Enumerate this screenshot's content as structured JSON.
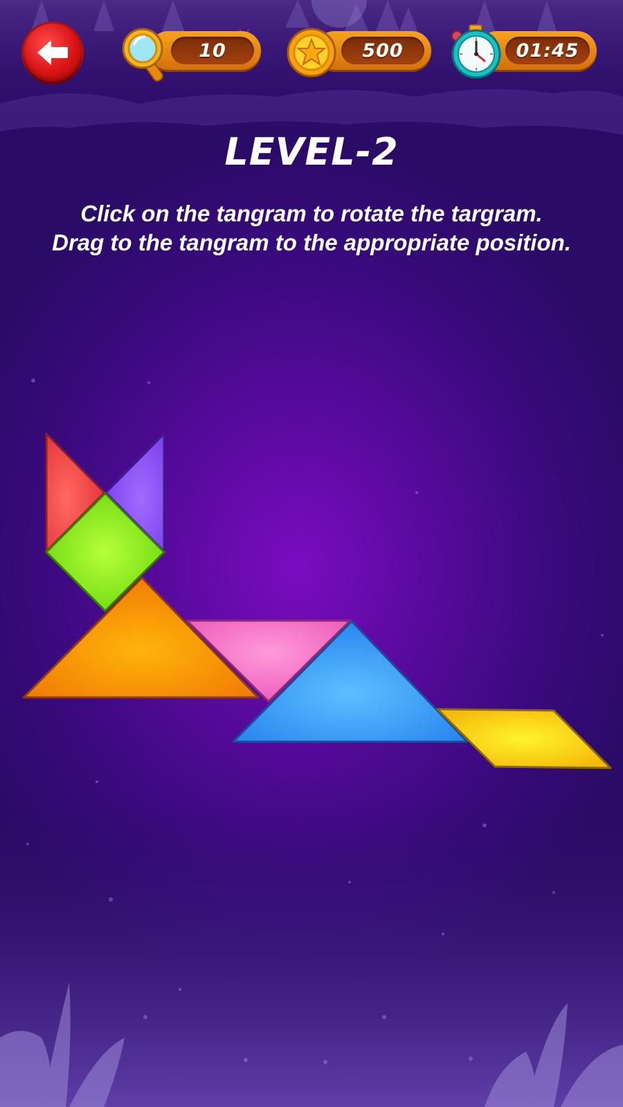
{
  "hud": {
    "back_icon": "arrow-left-icon",
    "hints": {
      "icon": "magnifier-icon",
      "value": "10"
    },
    "coins": {
      "icon": "star-coin-icon",
      "value": "500"
    },
    "timer": {
      "icon": "stopwatch-icon",
      "value": "01:45"
    }
  },
  "level": {
    "title": "LEVEL-2",
    "instruction_line1": "Click on the tangram to rotate the targram.",
    "instruction_line2": "Drag to the tangram to the appropriate position."
  },
  "colors": {
    "background": "#5a0a9f",
    "back_button": "#d81414",
    "pill": "#f29a1a",
    "pill_inner": "#8a3410",
    "piece_red": "#ee3f42",
    "piece_purple": "#8a4cf0",
    "piece_green": "#7ee011",
    "piece_orange": "#f58a05",
    "piece_pink": "#f16ec4",
    "piece_blue": "#2e93f5",
    "piece_yellow": "#f5c30b"
  },
  "pieces": [
    {
      "name": "small-triangle-red",
      "color": "#ee3f42"
    },
    {
      "name": "small-triangle-purple",
      "color": "#8a4cf0"
    },
    {
      "name": "square-green",
      "color": "#7ee011"
    },
    {
      "name": "large-triangle-orange",
      "color": "#f58a05"
    },
    {
      "name": "medium-triangle-pink",
      "color": "#f16ec4"
    },
    {
      "name": "large-triangle-blue",
      "color": "#2e93f5"
    },
    {
      "name": "parallelogram-yellow",
      "color": "#f5c30b"
    }
  ]
}
